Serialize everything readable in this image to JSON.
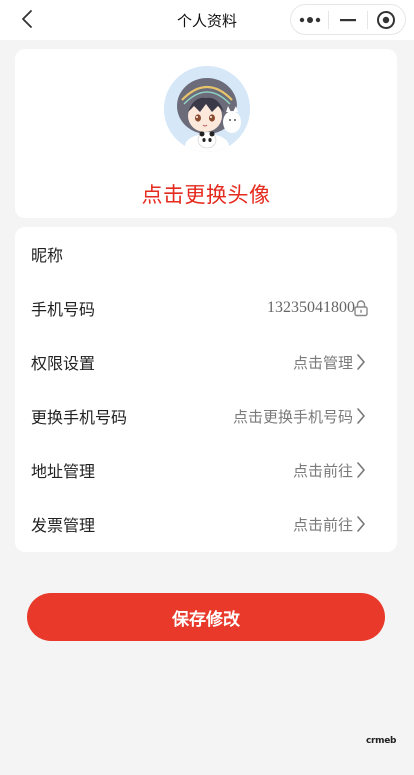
{
  "header": {
    "title": "个人资料"
  },
  "avatar_card": {
    "change_avatar_label": "点击更换头像"
  },
  "profile_rows": [
    {
      "label": "昵称",
      "value": ""
    },
    {
      "label": "手机号码",
      "value": "13235041800"
    },
    {
      "label": "权限设置",
      "value": "点击管理"
    },
    {
      "label": "更换手机号码",
      "value": "点击更换手机号码"
    },
    {
      "label": "地址管理",
      "value": "点击前往"
    },
    {
      "label": "发票管理",
      "value": "点击前往"
    }
  ],
  "actions": {
    "save_label": "保存修改"
  },
  "footer": {
    "brand": "crmeb"
  },
  "colors": {
    "accent": "#e8392b",
    "accent_text": "#e52a1e",
    "background": "#f4f4f5"
  },
  "icons": {
    "back": "chevron-left-icon",
    "more": "more-dots-icon",
    "minimize": "minimize-icon",
    "close": "close-circle-icon",
    "lock": "lock-icon",
    "chevron": "chevron-right-icon"
  }
}
